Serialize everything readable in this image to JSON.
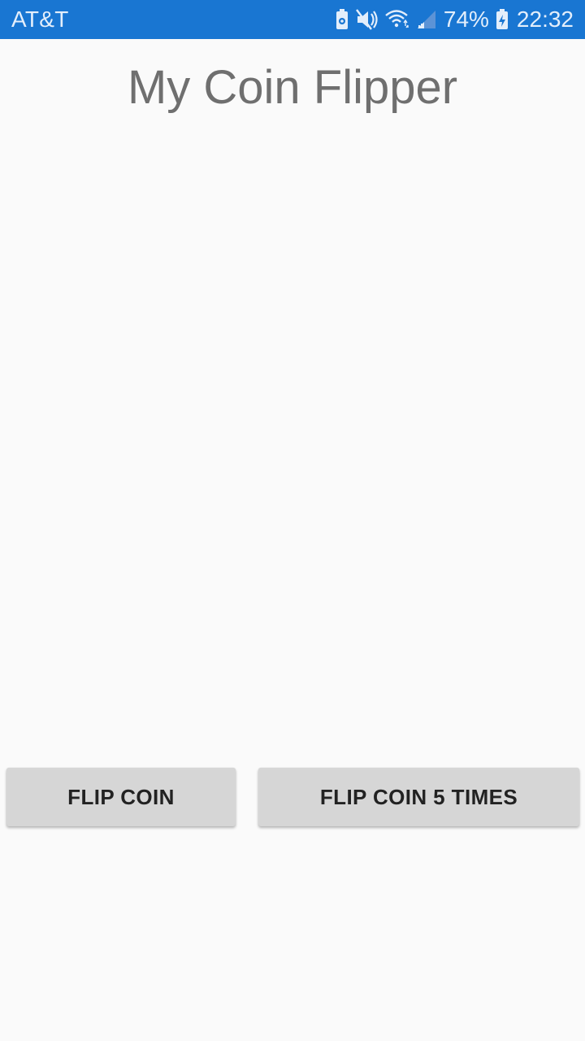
{
  "status_bar": {
    "carrier": "AT&T",
    "battery_percent": "74%",
    "time": "22:32",
    "icons": [
      "battery-saver-icon",
      "mute-icon",
      "wifi-icon",
      "signal-icon",
      "battery-charging-icon"
    ],
    "background_color": "#1976d2"
  },
  "app": {
    "title": "My Coin Flipper"
  },
  "buttons": {
    "flip_coin": "FLIP COIN",
    "flip_coin_5": "FLIP COIN 5 TIMES"
  }
}
